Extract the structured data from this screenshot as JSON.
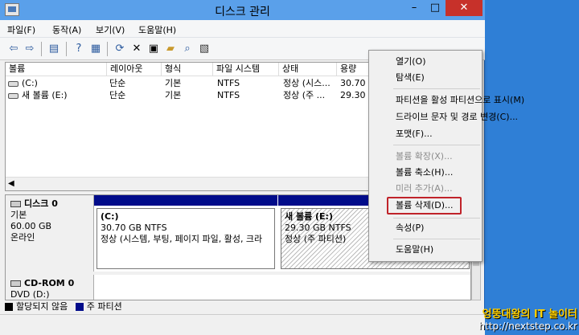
{
  "window": {
    "title": "디스크 관리",
    "minimize": "–",
    "maximize": "□",
    "close": "✕"
  },
  "menubar": [
    "파일(F)",
    "동작(A)",
    "보기(V)",
    "도움말(H)"
  ],
  "toolbar_icons": [
    "back-arrow-icon",
    "forward-arrow-icon",
    "console-tree-icon",
    "help-icon",
    "properties-icon",
    "refresh-icon",
    "delete-icon",
    "properties-page-icon",
    "open-folder-icon",
    "search-icon",
    "settings-icon"
  ],
  "volume_table": {
    "columns": [
      "볼륨",
      "레이아웃",
      "형식",
      "파일 시스템",
      "상태",
      "용량"
    ],
    "rows": [
      [
        "(C:)",
        "단순",
        "기본",
        "NTFS",
        "정상 (시스...",
        "30.70"
      ],
      [
        "새 볼륨 (E:)",
        "단순",
        "기본",
        "NTFS",
        "정상 (주 ...",
        "29.30"
      ]
    ]
  },
  "disks": [
    {
      "name": "디스크 0",
      "type": "기본",
      "size": "60.00 GB",
      "status": "온라인",
      "partitions": [
        {
          "title": "(C:)",
          "size": "30.70 GB NTFS",
          "status": "정상 (시스템, 부팅, 페이지 파일, 활성, 크라"
        },
        {
          "title": "새 볼륨  (E:)",
          "size": "29.30 GB NTFS",
          "status": "정상 (주 파티션)"
        }
      ]
    },
    {
      "name": "CD-ROM 0",
      "type": "DVD (D:)"
    }
  ],
  "legend": [
    {
      "label": "할당되지 않음",
      "color": "#000000"
    },
    {
      "label": "주 파티션",
      "color": "#010c8a"
    }
  ],
  "context_menu": {
    "items": [
      {
        "label": "열기(O)",
        "enabled": true
      },
      {
        "label": "탐색(E)",
        "enabled": true
      },
      {
        "label": "파티션을 활성 파티션으로 표시(M)",
        "enabled": true
      },
      {
        "label": "드라이브 문자 및 경로 변경(C)...",
        "enabled": true
      },
      {
        "label": "포맷(F)...",
        "enabled": true
      },
      {
        "label": "볼륨 확장(X)...",
        "enabled": false
      },
      {
        "label": "볼륨 축소(H)...",
        "enabled": true
      },
      {
        "label": "미러 추가(A)...",
        "enabled": false
      },
      {
        "label": "볼륨 삭제(D)...",
        "enabled": true
      },
      {
        "label": "속성(P)",
        "enabled": true
      },
      {
        "label": "도움말(H)",
        "enabled": true
      }
    ]
  },
  "watermark": {
    "line1": "엉뚱대왕의 IT 놀이터",
    "line2": "http://nextstep.co.kr"
  },
  "colors": {
    "titlebar": "#5aa0ea",
    "primary_partition": "#010c8a",
    "highlight_box": "#c0232a",
    "close_button": "#c7312a"
  }
}
